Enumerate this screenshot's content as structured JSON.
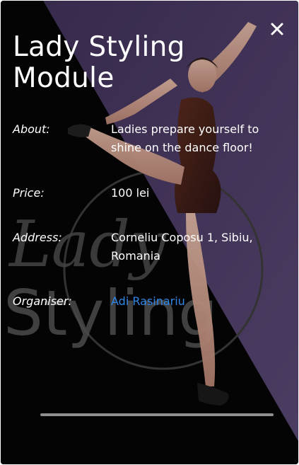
{
  "modal": {
    "title": "Lady Styling Module",
    "watermark_line1": "Lady",
    "watermark_line2": "Styling",
    "close_icon": "close-icon",
    "fields": {
      "about": {
        "label": "About:",
        "value": "Ladies prepare yourself to shine on the dance floor!"
      },
      "price": {
        "label": "Price:",
        "value": "100 lei"
      },
      "address": {
        "label": "Address:",
        "value": "Corneliu Coposu 1, Sibiu, Romania"
      },
      "organiser": {
        "label": "Organiser:",
        "value": "Adi Rasinariu"
      }
    }
  },
  "colors": {
    "background_purple": "#4a3a62",
    "text": "#ffffff",
    "link": "#2f86e6"
  }
}
